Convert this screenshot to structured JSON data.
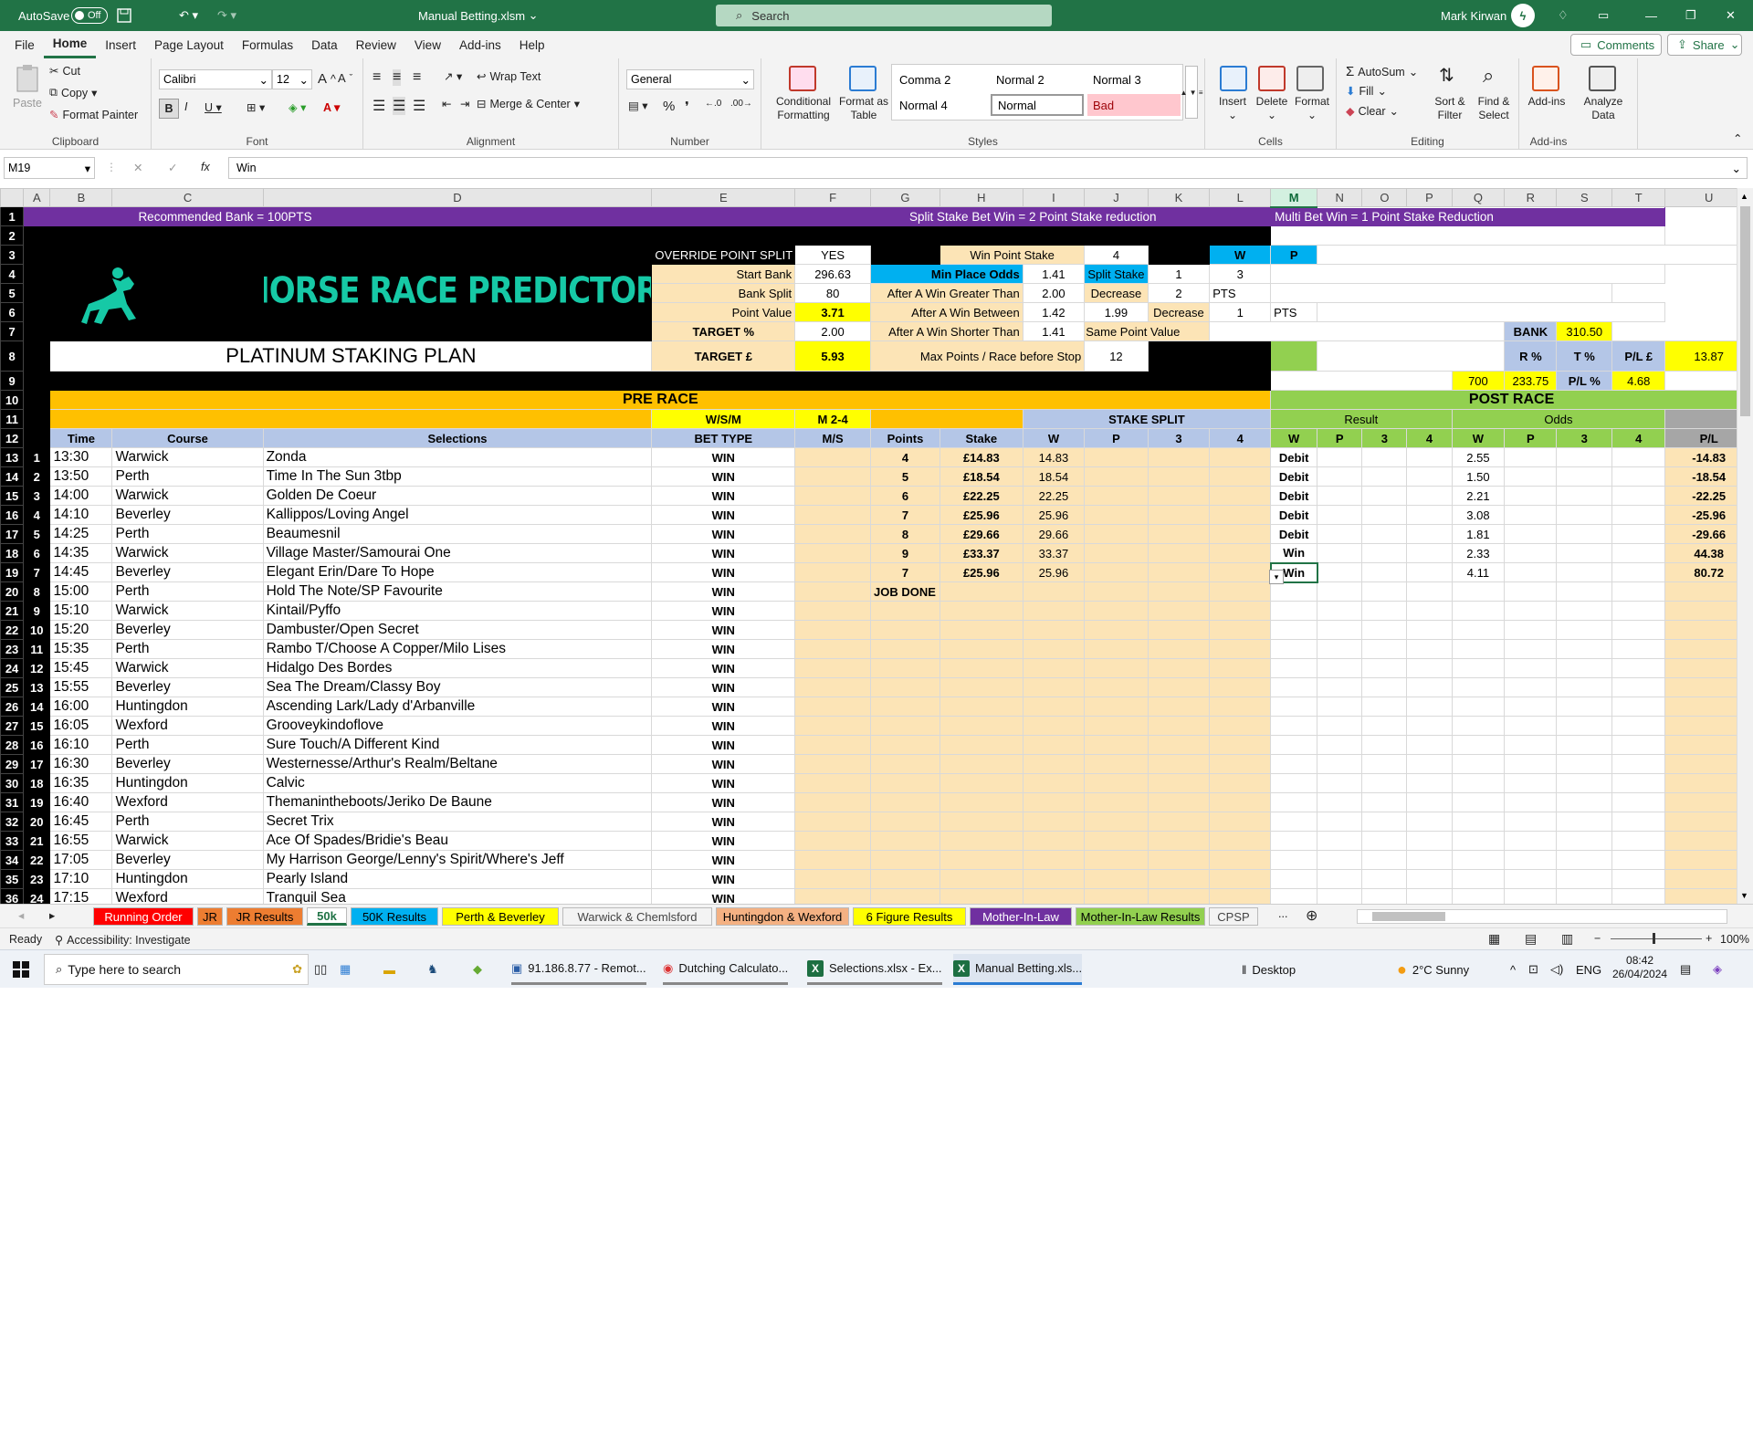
{
  "titlebar": {
    "autosave": "AutoSave",
    "autosave_state": "Off",
    "filename": "Manual Betting.xlsm",
    "search": "Search",
    "user": "Mark Kirwan"
  },
  "menu": [
    "File",
    "Home",
    "Insert",
    "Page Layout",
    "Formulas",
    "Data",
    "Review",
    "View",
    "Add-ins",
    "Help"
  ],
  "menu_right": {
    "comments": "Comments",
    "share": "Share"
  },
  "ribbon": {
    "clipboard": {
      "label": "Clipboard",
      "paste": "Paste",
      "cut": "Cut",
      "copy": "Copy",
      "format_painter": "Format Painter"
    },
    "font": {
      "label": "Font",
      "name": "Calibri",
      "size": "12"
    },
    "alignment": {
      "label": "Alignment",
      "wrap": "Wrap Text",
      "merge": "Merge & Center"
    },
    "number": {
      "label": "Number",
      "format": "General"
    },
    "styles": {
      "label": "Styles",
      "cond": "Conditional Formatting",
      "table": "Format as Table",
      "cells": [
        "Comma 2",
        "Normal 2",
        "Normal 3",
        "Normal 4",
        "Normal",
        "Bad"
      ]
    },
    "cells": {
      "label": "Cells",
      "insert": "Insert",
      "delete": "Delete",
      "format": "Format"
    },
    "editing": {
      "label": "Editing",
      "autosum": "AutoSum",
      "fill": "Fill",
      "clear": "Clear",
      "sort": "Sort & Filter",
      "find": "Find & Select"
    },
    "addins": {
      "label": "Add-ins",
      "addins": "Add-ins",
      "analyze": "Analyze Data"
    }
  },
  "formula_bar": {
    "cell_ref": "M19",
    "content": "Win"
  },
  "columns": [
    "",
    "A",
    "B",
    "C",
    "D",
    "E",
    "F",
    "G",
    "H",
    "I",
    "J",
    "K",
    "L",
    "M",
    "N",
    "O",
    "P",
    "Q",
    "R",
    "S",
    "T",
    "U"
  ],
  "sheet": {
    "r1": {
      "left": "Recommended Bank = 100PTS",
      "mid": "Split Stake Bet Win = 2 Point Stake reduction",
      "right": "Multi Bet Win = 1 Point  Stake Reduction"
    },
    "r3": {
      "override": "OVERRIDE POINT SPLIT",
      "yes": "YES",
      "win_point_stake": "Win Point Stake",
      "wps": "4",
      "w": "W",
      "p": "P"
    },
    "r4": {
      "start_bank": "Start Bank",
      "sb": "296.63",
      "min_place": "Min Place Odds",
      "mpo": "1.41",
      "split": "Split Stake",
      "w": "1",
      "p": "3"
    },
    "r5": {
      "bank_split": "Bank Split",
      "bs": "80",
      "greater": "After A Win Greater Than",
      "g": "2.00",
      "dec": "Decrease",
      "d": "2",
      "pts": "PTS"
    },
    "r6": {
      "point_value": "Point Value",
      "pv": "3.71",
      "between": "After A Win Between",
      "b1": "1.42",
      "b2": "1.99",
      "dec": "Decrease",
      "d": "1",
      "pts": "PTS"
    },
    "r7": {
      "target_pct": "TARGET %",
      "tp": "2.00",
      "shorter": "After A Win Shorter Than",
      "s": "1.41",
      "same": "Same Point Value",
      "bank": "BANK",
      "bv": "310.50"
    },
    "r8": {
      "plan": "PLATINUM STAKING PLAN",
      "target": "TARGET £",
      "tv": "5.93",
      "max": "Max Points / Race before Stop",
      "mv": "12",
      "r": "R %",
      "t": "T %",
      "pl": "P/L £",
      "plv": "13.87"
    },
    "r9": {
      "r": "700",
      "t": "233.75",
      "plp": "P/L %",
      "plpv": "4.68"
    },
    "logo": "THE HORSE RACE PREDICTOR",
    "r10": {
      "pre": "PRE RACE",
      "post": "POST RACE"
    },
    "r11": {
      "wsm": "W/S/M",
      "m24": "M 2-4",
      "split": "STAKE SPLIT",
      "result": "Result",
      "odds": "Odds"
    },
    "r12": [
      "Time",
      "Course",
      "Selections",
      "BET TYPE",
      "M/S",
      "Points",
      "Stake",
      "W",
      "P",
      "3",
      "4",
      "W",
      "P",
      "3",
      "4",
      "W",
      "P",
      "3",
      "4",
      "P/L"
    ],
    "rows": [
      {
        "r": "13",
        "n": "1",
        "t": "13:30",
        "c": "Warwick",
        "s": "Zonda",
        "bt": "WIN",
        "pts": "4",
        "st": "£14.83",
        "w": "14.83",
        "res": "Debit",
        "odds": "2.55",
        "pl": "-14.83"
      },
      {
        "r": "14",
        "n": "2",
        "t": "13:50",
        "c": "Perth",
        "s": "Time In The Sun 3tbp",
        "bt": "WIN",
        "pts": "5",
        "st": "£18.54",
        "w": "18.54",
        "res": "Debit",
        "odds": "1.50",
        "pl": "-18.54"
      },
      {
        "r": "15",
        "n": "3",
        "t": "14:00",
        "c": "Warwick",
        "s": "Golden De Coeur",
        "bt": "WIN",
        "pts": "6",
        "st": "£22.25",
        "w": "22.25",
        "res": "Debit",
        "odds": "2.21",
        "pl": "-22.25"
      },
      {
        "r": "16",
        "n": "4",
        "t": "14:10",
        "c": "Beverley",
        "s": "Kallippos/Loving Angel",
        "bt": "WIN",
        "pts": "7",
        "st": "£25.96",
        "w": "25.96",
        "res": "Debit",
        "odds": "3.08",
        "pl": "-25.96"
      },
      {
        "r": "17",
        "n": "5",
        "t": "14:25",
        "c": "Perth",
        "s": "Beaumesnil",
        "bt": "WIN",
        "pts": "8",
        "st": "£29.66",
        "w": "29.66",
        "res": "Debit",
        "odds": "1.81",
        "pl": "-29.66"
      },
      {
        "r": "18",
        "n": "6",
        "t": "14:35",
        "c": "Warwick",
        "s": "Village Master/Samourai One",
        "bt": "WIN",
        "pts": "9",
        "st": "£33.37",
        "w": "33.37",
        "res": "Win",
        "odds": "2.33",
        "pl": "44.38"
      },
      {
        "r": "19",
        "n": "7",
        "t": "14:45",
        "c": "Beverley",
        "s": "Elegant Erin/Dare To Hope",
        "bt": "WIN",
        "pts": "7",
        "st": "£25.96",
        "w": "25.96",
        "res": "Win",
        "odds": "4.11",
        "pl": "80.72"
      },
      {
        "r": "20",
        "n": "8",
        "t": "15:00",
        "c": "Perth",
        "s": "Hold The Note/SP Favourite",
        "bt": "WIN",
        "pts": "JOB DONE",
        "st": "",
        "w": "",
        "res": "",
        "odds": "",
        "pl": ""
      },
      {
        "r": "21",
        "n": "9",
        "t": "15:10",
        "c": "Warwick",
        "s": "Kintail/Pyffo",
        "bt": "WIN"
      },
      {
        "r": "22",
        "n": "10",
        "t": "15:20",
        "c": "Beverley",
        "s": "Dambuster/Open Secret",
        "bt": "WIN"
      },
      {
        "r": "23",
        "n": "11",
        "t": "15:35",
        "c": "Perth",
        "s": "Rambo T/Choose A Copper/Milo Lises",
        "bt": "WIN"
      },
      {
        "r": "24",
        "n": "12",
        "t": "15:45",
        "c": "Warwick",
        "s": "Hidalgo Des Bordes",
        "bt": "WIN"
      },
      {
        "r": "25",
        "n": "13",
        "t": "15:55",
        "c": "Beverley",
        "s": "Sea The Dream/Classy Boy",
        "bt": "WIN"
      },
      {
        "r": "26",
        "n": "14",
        "t": "16:00",
        "c": "Huntingdon",
        "s": "Ascending Lark/Lady d'Arbanville",
        "bt": "WIN"
      },
      {
        "r": "27",
        "n": "15",
        "t": "16:05",
        "c": "Wexford",
        "s": "Grooveykindoflove",
        "bt": "WIN"
      },
      {
        "r": "28",
        "n": "16",
        "t": "16:10",
        "c": "Perth",
        "s": "Sure Touch/A Different Kind",
        "bt": "WIN"
      },
      {
        "r": "29",
        "n": "17",
        "t": "16:30",
        "c": "Beverley",
        "s": "Westernesse/Arthur's Realm/Beltane",
        "bt": "WIN"
      },
      {
        "r": "30",
        "n": "18",
        "t": "16:35",
        "c": "Huntingdon",
        "s": "Calvic",
        "bt": "WIN"
      },
      {
        "r": "31",
        "n": "19",
        "t": "16:40",
        "c": "Wexford",
        "s": "Themanintheboots/Jeriko De Baune",
        "bt": "WIN"
      },
      {
        "r": "32",
        "n": "20",
        "t": "16:45",
        "c": "Perth",
        "s": "Secret Trix",
        "bt": "WIN"
      },
      {
        "r": "33",
        "n": "21",
        "t": "16:55",
        "c": "Warwick",
        "s": "Ace Of Spades/Bridie's Beau",
        "bt": "WIN"
      },
      {
        "r": "34",
        "n": "22",
        "t": "17:05",
        "c": "Beverley",
        "s": "My Harrison George/Lenny's Spirit/Where's Jeff",
        "bt": "WIN"
      },
      {
        "r": "35",
        "n": "23",
        "t": "17:10",
        "c": "Huntingdon",
        "s": "Pearly Island",
        "bt": "WIN"
      },
      {
        "r": "36",
        "n": "24",
        "t": "17:15",
        "c": "Wexford",
        "s": "Tranquil Sea",
        "bt": "WIN"
      }
    ]
  },
  "tabs": [
    {
      "label": "Running Order",
      "bg": "#ff0000",
      "fg": "#ffffff"
    },
    {
      "label": "JR",
      "bg": "#ed7d31",
      "fg": "#000000"
    },
    {
      "label": "JR Results",
      "bg": "#ed7d31",
      "fg": "#000000"
    },
    {
      "label": "50k",
      "bg": "#ffffff",
      "fg": "#217346"
    },
    {
      "label": "50K Results",
      "bg": "#00b0f0",
      "fg": "#000000"
    },
    {
      "label": "Perth & Beverley",
      "bg": "#ffff00",
      "fg": "#000000"
    },
    {
      "label": "Warwick & Chemlsford",
      "bg": "#f3f3f3",
      "fg": "#444444"
    },
    {
      "label": "Huntingdon & Wexford",
      "bg": "#f4b183",
      "fg": "#000000"
    },
    {
      "label": "6 Figure Results",
      "bg": "#ffff00",
      "fg": "#000000"
    },
    {
      "label": "Mother-In-Law",
      "bg": "#7030a0",
      "fg": "#ffffff"
    },
    {
      "label": "Mother-In-Law Results",
      "bg": "#92d050",
      "fg": "#000000"
    },
    {
      "label": "CPSP",
      "bg": "#f3f3f3",
      "fg": "#444444"
    }
  ],
  "tabs_more": "...",
  "status": {
    "ready": "Ready",
    "access": "Accessibility: Investigate",
    "zoom": "100%"
  },
  "taskbar": {
    "search": "Type here to search",
    "apps": [
      "91.186.8.77 - Remot...",
      "Dutching Calculato...",
      "Selections.xlsx - Ex...",
      "Manual Betting.xls..."
    ],
    "desktop": "Desktop",
    "weather": "2°C  Sunny",
    "lang": "ENG",
    "time": "08:42",
    "date": "26/04/2024"
  }
}
